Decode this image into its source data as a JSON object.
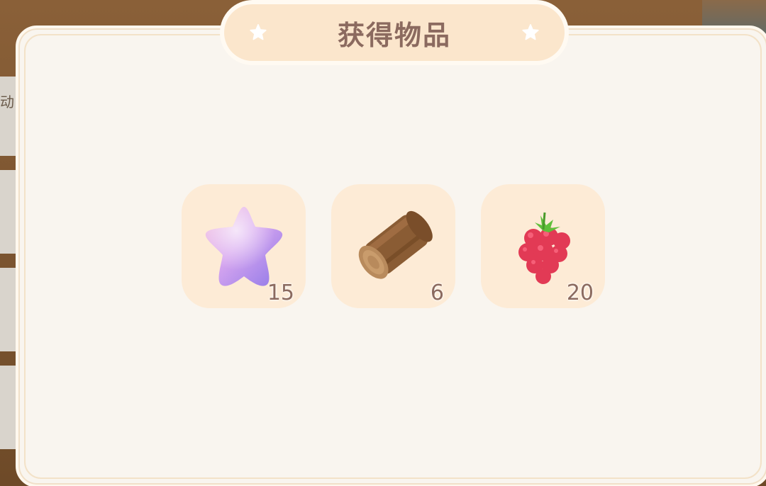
{
  "dialog": {
    "title": "获得物品",
    "title_color": "#8b6a5f",
    "banner_color": "#fbe6cc"
  },
  "background": {
    "side_label": "动"
  },
  "items": [
    {
      "icon": "purple-star-icon",
      "count": "15"
    },
    {
      "icon": "wood-log-icon",
      "count": "6"
    },
    {
      "icon": "raspberry-icon",
      "count": "20"
    }
  ],
  "colors": {
    "panel": "#f9f5ef",
    "slot": "#fdebd6",
    "count_text": "#8b6a5f"
  }
}
